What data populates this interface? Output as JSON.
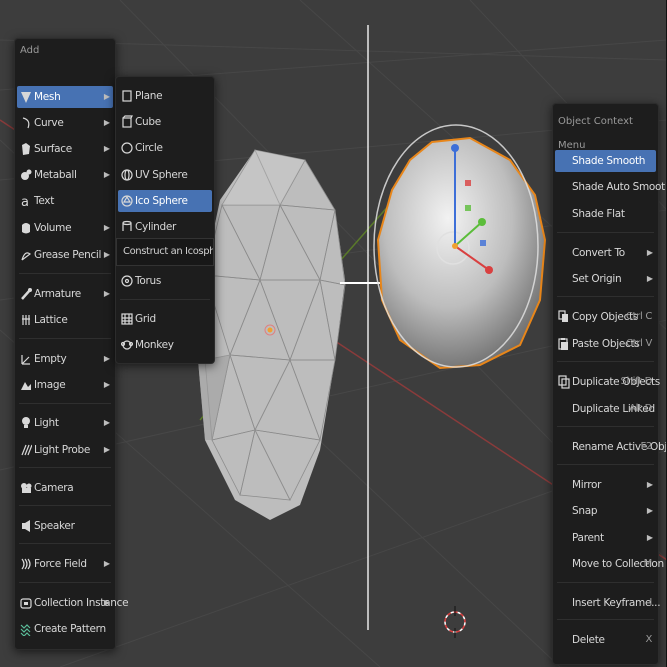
{
  "add_menu": {
    "title": "Add",
    "items": [
      {
        "label": "Mesh",
        "icon": "mesh-icon",
        "has_submenu": true,
        "active": true
      },
      {
        "label": "Curve",
        "icon": "curve-icon",
        "has_submenu": true
      },
      {
        "label": "Surface",
        "icon": "surface-icon",
        "has_submenu": true
      },
      {
        "label": "Metaball",
        "icon": "metaball-icon",
        "has_submenu": true
      },
      {
        "label": "Text",
        "icon": "text-icon",
        "has_submenu": false
      },
      {
        "label": "Volume",
        "icon": "volume-icon",
        "has_submenu": true
      },
      {
        "label": "Grease Pencil",
        "icon": "grease-pencil-icon",
        "has_submenu": true
      },
      {
        "label": "Armature",
        "icon": "armature-icon",
        "has_submenu": true
      },
      {
        "label": "Lattice",
        "icon": "lattice-icon",
        "has_submenu": false
      },
      {
        "label": "Empty",
        "icon": "empty-icon",
        "has_submenu": true
      },
      {
        "label": "Image",
        "icon": "image-icon",
        "has_submenu": true
      },
      {
        "label": "Light",
        "icon": "light-icon",
        "has_submenu": true
      },
      {
        "label": "Light Probe",
        "icon": "light-probe-icon",
        "has_submenu": true
      },
      {
        "label": "Camera",
        "icon": "camera-icon",
        "has_submenu": false
      },
      {
        "label": "Speaker",
        "icon": "speaker-icon",
        "has_submenu": false
      },
      {
        "label": "Force Field",
        "icon": "force-field-icon",
        "has_submenu": true
      },
      {
        "label": "Collection Instance",
        "icon": "collection-instance-icon",
        "has_submenu": true
      },
      {
        "label": "Create Pattern",
        "icon": "create-pattern-icon",
        "has_submenu": false
      }
    ]
  },
  "mesh_submenu": {
    "items": [
      {
        "label": "Plane",
        "icon": "plane-icon"
      },
      {
        "label": "Cube",
        "icon": "cube-icon"
      },
      {
        "label": "Circle",
        "icon": "circle-icon"
      },
      {
        "label": "UV Sphere",
        "icon": "uv-sphere-icon"
      },
      {
        "label": "Ico Sphere",
        "icon": "ico-sphere-icon",
        "active": true
      },
      {
        "label": "Cylinder",
        "icon": "cylinder-icon"
      },
      {
        "label": "Torus",
        "icon": "torus-icon"
      },
      {
        "label": "Grid",
        "icon": "grid-icon"
      },
      {
        "label": "Monkey",
        "icon": "monkey-icon"
      }
    ],
    "tooltip": "Construct an Icosphere mesh."
  },
  "context_menu": {
    "title": "Object Context Menu",
    "items": [
      {
        "label": "Shade Smooth",
        "active": true
      },
      {
        "label": "Shade Auto Smooth"
      },
      {
        "label": "Shade Flat"
      },
      {
        "label": "Convert To",
        "has_submenu": true
      },
      {
        "label": "Set Origin",
        "has_submenu": true
      },
      {
        "label": "Copy Objects",
        "shortcut": "Ctrl C",
        "icon": "copy-icon"
      },
      {
        "label": "Paste Objects",
        "shortcut": "Ctrl V",
        "icon": "paste-icon"
      },
      {
        "label": "Duplicate Objects",
        "shortcut": "Shift D",
        "icon": "duplicate-icon"
      },
      {
        "label": "Duplicate Linked",
        "shortcut": "Alt D"
      },
      {
        "label": "Rename Active Object...",
        "shortcut": "F2"
      },
      {
        "label": "Mirror",
        "has_submenu": true
      },
      {
        "label": "Snap",
        "has_submenu": true
      },
      {
        "label": "Parent",
        "has_submenu": true
      },
      {
        "label": "Move to Collection",
        "shortcut": "M"
      },
      {
        "label": "Insert Keyframe...",
        "shortcut": "I"
      },
      {
        "label": "Delete",
        "shortcut": "X"
      }
    ]
  },
  "colors": {
    "menu_bg": "#1d1d1d",
    "highlight": "#4772b3",
    "selection_outline": "#e8861a",
    "viewport_bg": "#3d3d3d",
    "grid_line": "#4a4a4a",
    "x_axis": "#8a3b3b",
    "y_axis": "#5a7a2a"
  }
}
